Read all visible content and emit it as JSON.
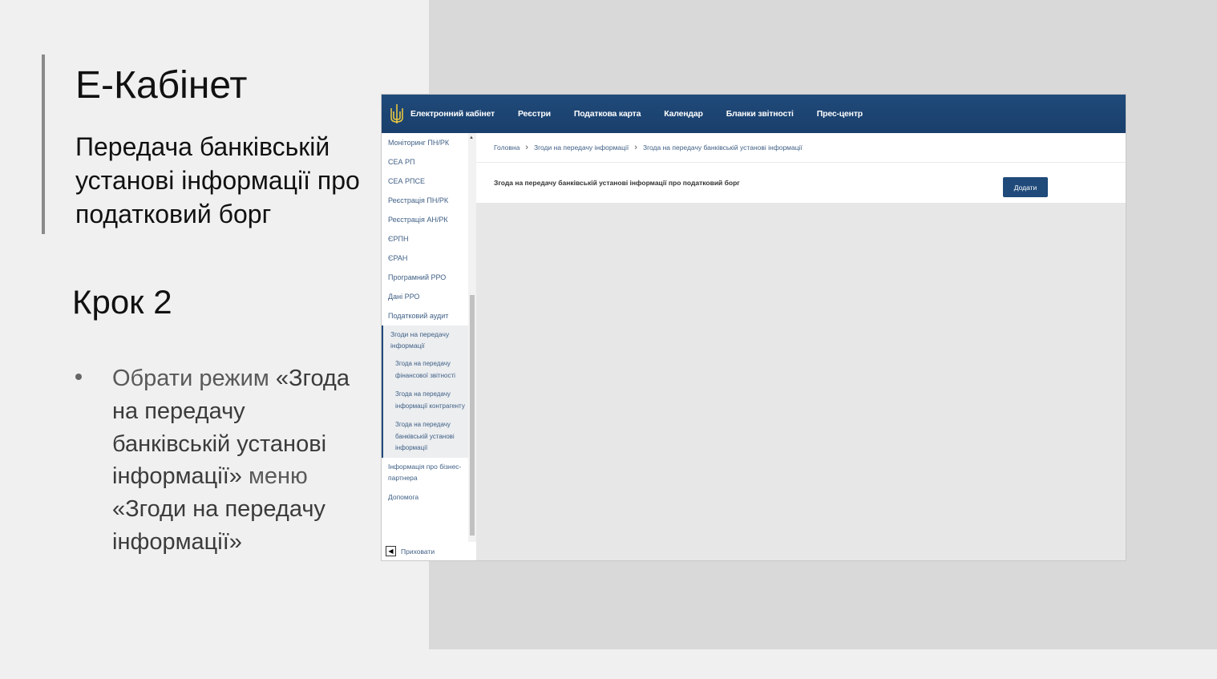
{
  "slide": {
    "title": "Е-Кабінет",
    "subtitle": "Передача банківській установі інформації про податковий борг",
    "step": "Крок 2",
    "bullet": {
      "part1": "Обрати режим ",
      "part2": "«Згода на передачу банківській установі інформації»",
      "part3": " меню ",
      "part4": "«Згоди на передачу інформації»"
    }
  },
  "topnav": {
    "logo_icon": "trident-icon",
    "items": [
      "Електронний кабінет",
      "Реєстри",
      "Податкова карта",
      "Календар",
      "Бланки звітності",
      "Прес-центр"
    ]
  },
  "sidebar": {
    "items": [
      "Моніторинг ПН/РК",
      "СЕА РП",
      "СЕА РПСЕ",
      "Реєстрація ПН/РК",
      "Реєстрація АН/РК",
      "ЄРПН",
      "ЄРАН",
      "Програмний РРО",
      "Дані РРО",
      "Податковий аудит"
    ],
    "group_title": "Згоди на передачу інформації",
    "sub_items": [
      "Згода на передачу фінансової звітності",
      "Згода на передачу інформації контрагенту",
      "Згода на передачу банківській установі інформації"
    ],
    "after_items": [
      "Інформація про бізнес-партнера",
      "Допомога"
    ],
    "hide_label": "Приховати"
  },
  "breadcrumb": [
    "Головна",
    "Згоди на передачу інформації",
    "Згода на передачу банківській установі інформації"
  ],
  "panel": {
    "title": "Згода на передачу банківській установі інформації про податковий борг",
    "add_label": "Додати"
  }
}
